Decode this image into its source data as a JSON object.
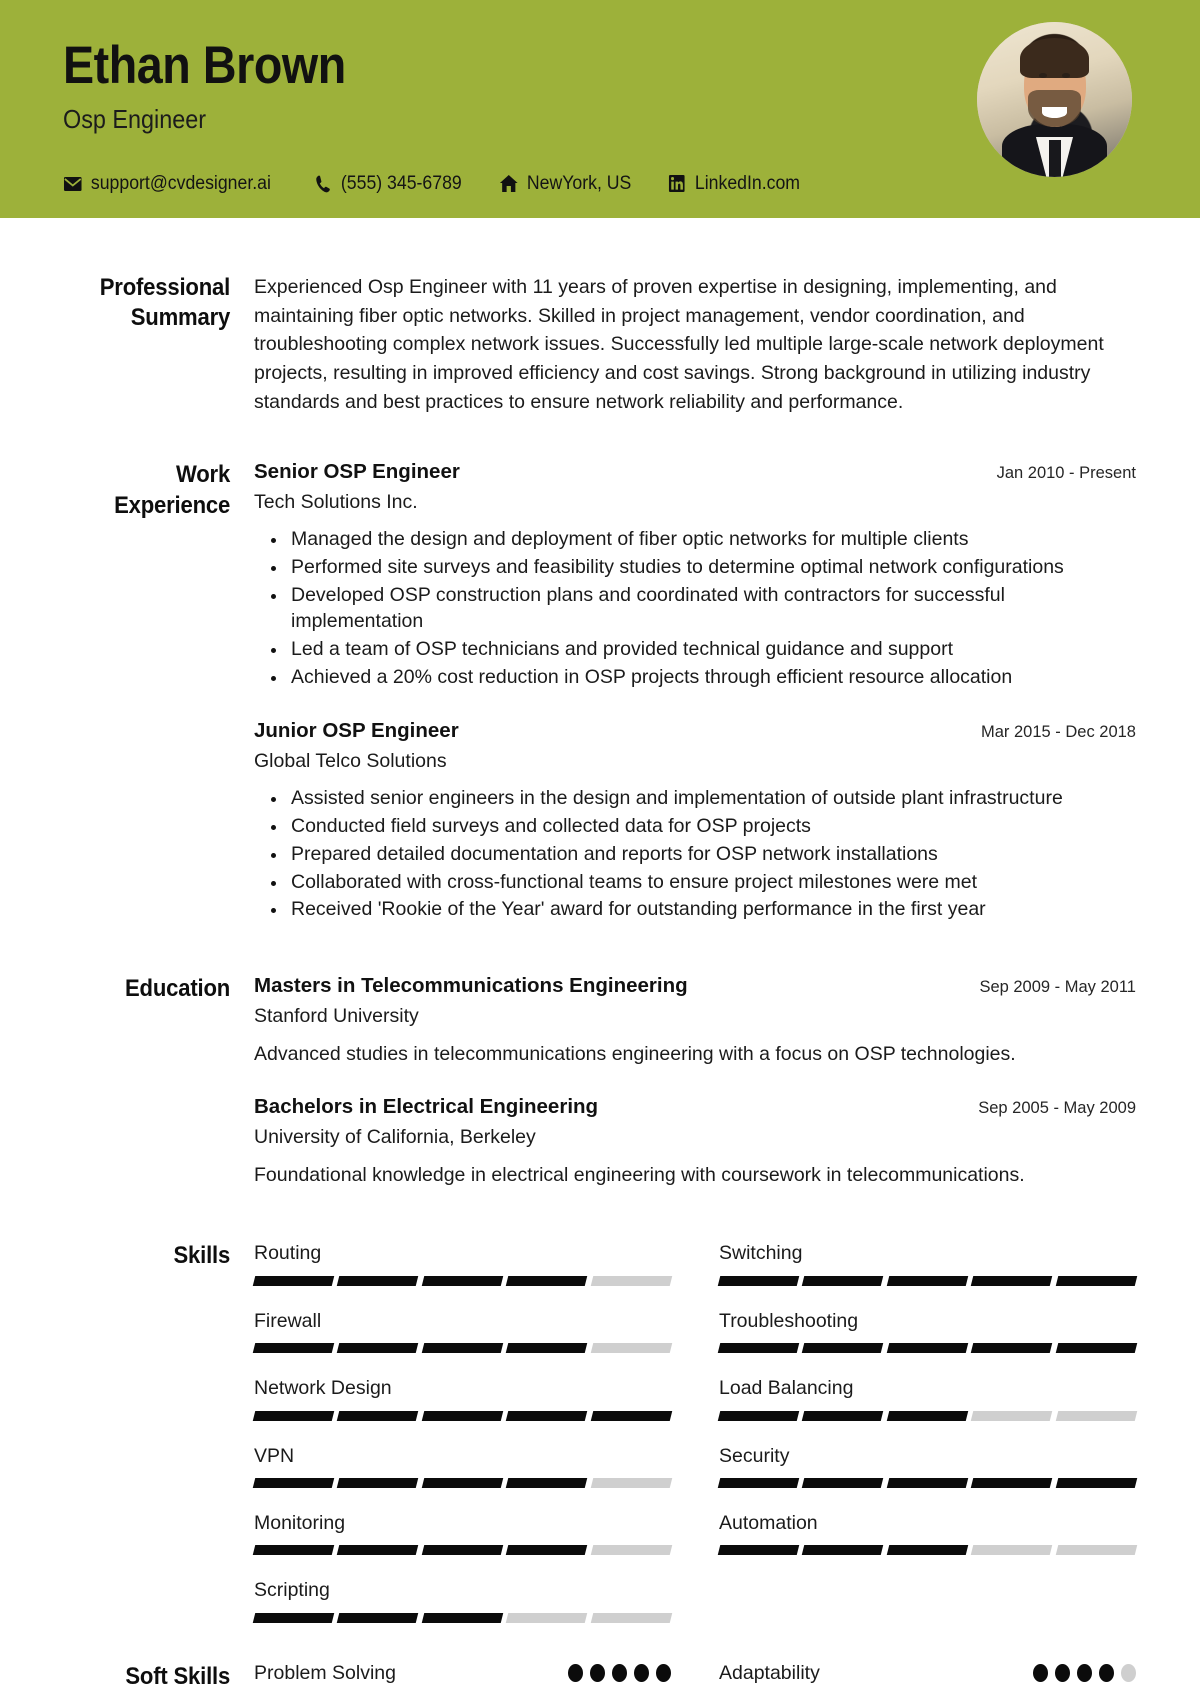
{
  "theme": {
    "header_bg": "#9DB13A",
    "text": "#1b1b1b",
    "bar_on": "#0b0b0b",
    "bar_off": "#cfcfcf"
  },
  "header": {
    "name": "Ethan Brown",
    "job_title": "Osp Engineer",
    "contacts": [
      {
        "icon": "email-icon",
        "value": "support@cvdesigner.ai"
      },
      {
        "icon": "phone-icon",
        "value": "(555) 345-6789"
      },
      {
        "icon": "home-icon",
        "value": "NewYork, US"
      },
      {
        "icon": "linkedin-icon",
        "value": "LinkedIn.com"
      }
    ]
  },
  "summary": {
    "label": "Professional Summary",
    "text": "Experienced Osp Engineer with 11 years of proven expertise in designing, implementing, and maintaining fiber optic networks. Skilled in project management, vendor coordination, and troubleshooting complex network issues. Successfully led multiple large-scale network deployment projects, resulting in improved efficiency and cost savings. Strong background in utilizing industry standards and best practices to ensure network reliability and performance."
  },
  "work": {
    "label": "Work Experience",
    "entries": [
      {
        "title": "Senior OSP Engineer",
        "company": "Tech Solutions Inc.",
        "date": "Jan 2010 - Present",
        "bullets": [
          "Managed the design and deployment of fiber optic networks for multiple clients",
          "Performed site surveys and feasibility studies to determine optimal network configurations",
          "Developed OSP construction plans and coordinated with contractors for successful implementation",
          "Led a team of OSP technicians and provided technical guidance and support",
          "Achieved a 20% cost reduction in OSP projects through efficient resource allocation"
        ]
      },
      {
        "title": "Junior OSP Engineer",
        "company": "Global Telco Solutions",
        "date": "Mar 2015 - Dec 2018",
        "bullets": [
          "Assisted senior engineers in the design and implementation of outside plant infrastructure",
          "Conducted field surveys and collected data for OSP projects",
          "Prepared detailed documentation and reports for OSP network installations",
          "Collaborated with cross-functional teams to ensure project milestones were met",
          "Received 'Rookie of the Year' award for outstanding performance in the first year"
        ]
      }
    ]
  },
  "education": {
    "label": "Education",
    "entries": [
      {
        "degree": "Masters in Telecommunications Engineering",
        "school": "Stanford University",
        "date": "Sep 2009 - May 2011",
        "description": "Advanced studies in telecommunications engineering with a focus on OSP technologies."
      },
      {
        "degree": "Bachelors in Electrical Engineering",
        "school": "University of California, Berkeley",
        "date": "Sep 2005 - May 2009",
        "description": "Foundational knowledge in electrical engineering with coursework in telecommunications."
      }
    ]
  },
  "skills": {
    "label": "Skills",
    "max": 5,
    "items": [
      {
        "name": "Routing",
        "level": 4
      },
      {
        "name": "Switching",
        "level": 5
      },
      {
        "name": "Firewall",
        "level": 4
      },
      {
        "name": "Troubleshooting",
        "level": 5
      },
      {
        "name": "Network Design",
        "level": 5
      },
      {
        "name": "Load Balancing",
        "level": 3
      },
      {
        "name": "VPN",
        "level": 4
      },
      {
        "name": "Security",
        "level": 5
      },
      {
        "name": "Monitoring",
        "level": 4
      },
      {
        "name": "Automation",
        "level": 3
      },
      {
        "name": "Scripting",
        "level": 3
      }
    ]
  },
  "soft_skills": {
    "label": "Soft Skills",
    "max": 5,
    "items": [
      {
        "name": "Problem Solving",
        "level": 5
      },
      {
        "name": "Adaptability",
        "level": 4
      }
    ]
  }
}
